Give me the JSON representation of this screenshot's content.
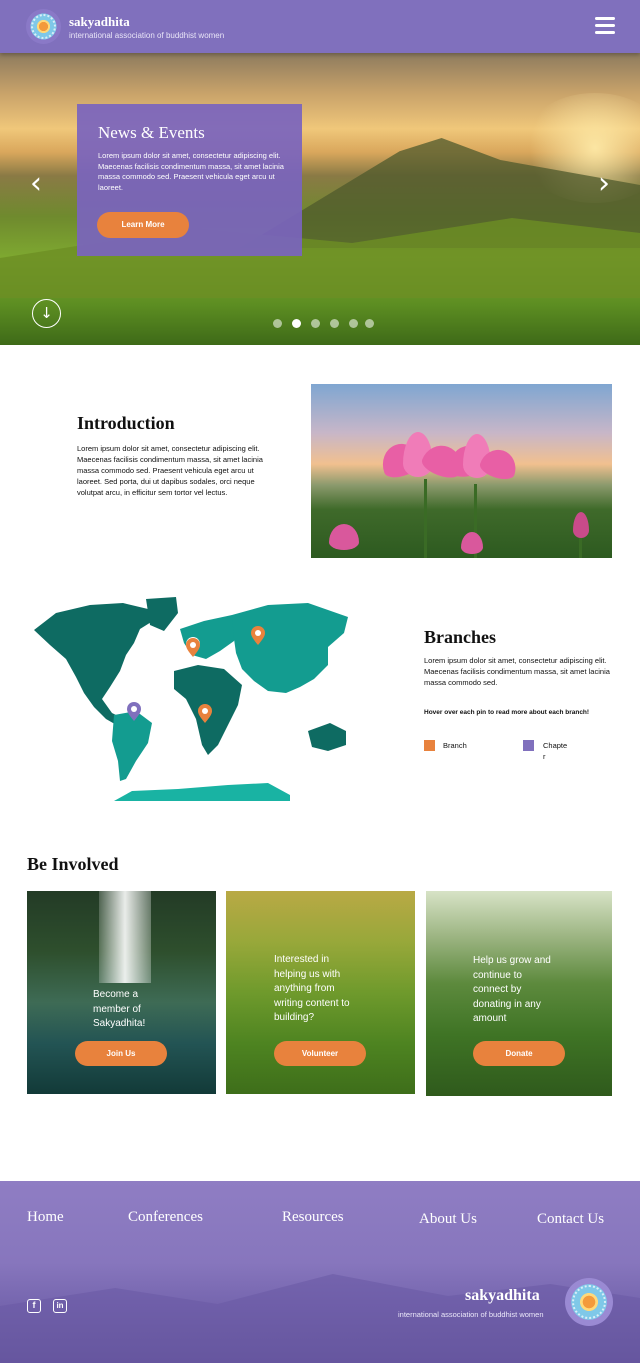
{
  "header": {
    "brand_title": "sakyadhita",
    "brand_subtitle": "international association of buddhist women"
  },
  "hero": {
    "card_title": "News & Events",
    "card_text": "Lorem ipsum dolor sit amet, consectetur adipiscing elit. Maecenas facilisis condimentum massa, sit amet lacinia massa commodo sed. Praesent vehicula eget arcu ut laoreet.",
    "button_label": "Learn More",
    "prev_glyph": "‹",
    "next_glyph": "›",
    "scroll_glyph": "↓",
    "slide_count": 6,
    "active_slide": 2
  },
  "intro": {
    "title": "Introduction",
    "text": "Lorem ipsum dolor sit amet, consectetur adipiscing elit. Maecenas facilisis condimentum massa, sit amet lacinia massa commodo sed. Praesent vehicula eget arcu ut laoreet. Sed porta, dui ut dapibus sodales, orci neque volutpat arcu, in efficitur sem tortor vel lectus."
  },
  "branches": {
    "title": "Branches",
    "text": "Lorem ipsum dolor sit amet, consectetur adipiscing elit. Maecenas facilisis condimentum massa, sit amet lacinia massa commodo sed.",
    "hint": "Hover over each pin to read more about each branch!",
    "legend": [
      {
        "label": "Branch",
        "color": "#e8823d"
      },
      {
        "label": "Chapte\nr",
        "color": "#8070bd"
      }
    ]
  },
  "involved": {
    "title": "Be Involved",
    "cards": [
      {
        "text": "Become a\nmember of\nSakyadhita!",
        "button": "Join Us"
      },
      {
        "text": "Interested in\nhelping us with\nanything from\nwriting content to\nbuilding?",
        "button": "Volunteer"
      },
      {
        "text": "Help us grow and\ncontinue to\nconnect by\ndonating in any\namount",
        "button": "Donate"
      }
    ]
  },
  "footer": {
    "nav": [
      "Home",
      "Conferences",
      "Resources",
      "About Us",
      "Contact Us"
    ],
    "social": [
      "f",
      "in"
    ],
    "brand_title": "sakyadhita",
    "brand_subtitle": "international association of buddhist women"
  },
  "colors": {
    "brand_purple": "#8070bd",
    "accent_orange": "#e8823d",
    "map_teal": "#0f8f85"
  },
  "icons": [
    "logo-mandala-icon",
    "hamburger-menu-icon",
    "chevron-left-icon",
    "chevron-right-icon",
    "arrow-down-circle-icon",
    "map-pin-icon",
    "facebook-icon",
    "linkedin-icon"
  ]
}
